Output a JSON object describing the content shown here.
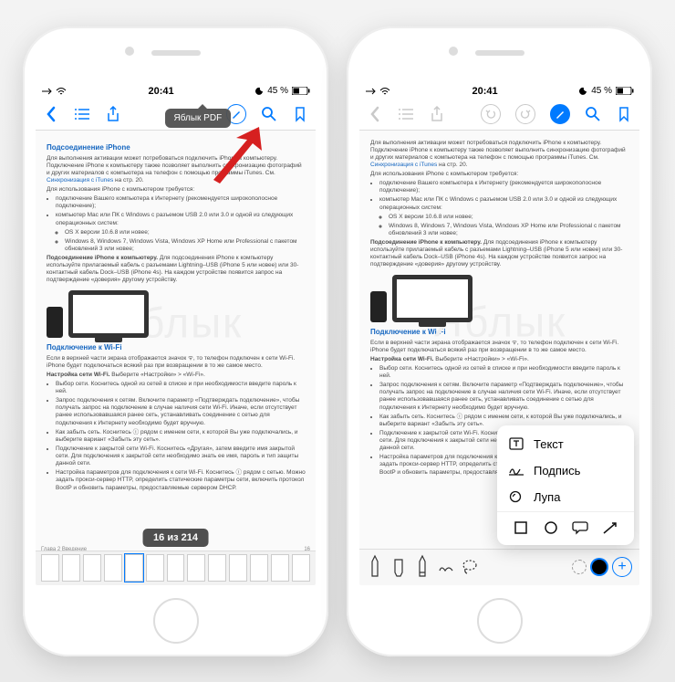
{
  "status": {
    "time": "20:41",
    "battery": "45 %"
  },
  "tooltip": "Яблык PDF",
  "page_indicator": "16 из 214",
  "watermark": "Яблык",
  "doc": {
    "h1": "Подсоединение iPhone",
    "p1": "Для выполнения активации может потребоваться подключить iPhone к компьютеру. Подключение iPhone к компьютеру также позволяет выполнить синхронизацию фотографий и других материалов с компьютера на телефон с помощью программы iTunes. См.",
    "link1": "Синхронизация с iTunes",
    "link1_after": " на стр. 20.",
    "p2": "Для использования iPhone с компьютером требуется:",
    "li1": "подключение Вашего компьютера к Интернету (рекомендуется широкополосное подключение);",
    "li2": "компьютер Mac или ПК с Windows с разъемом USB 2.0 или 3.0 и одной из следующих операционных систем:",
    "li2a": "OS X версии 10.6.8 или новее;",
    "li2b": "Windows 8, Windows 7, Windows Vista, Windows XP Home или Professional с пакетом обновлений 3 или новее;",
    "p3_strong": "Подсоединение iPhone к компьютеру.",
    "p3": " Для подсоединения iPhone к компьютеру используйте прилагаемый кабель с разъемами Lightning–USB (iPhone 5 или новее) или 30-контактный кабель Dock–USB (iPhone 4s). На каждом устройстве появится запрос на подтверждение «доверия» другому устройству.",
    "h2": "Подключение к Wi-Fi",
    "p4": "Если в верхней части экрана отображается значок ᯤ, то телефон подключен к сети Wi-Fi. iPhone будет подключаться всякий раз при возвращении в то же самое место.",
    "p5_strong": "Настройка сети Wi-Fi.",
    "p5": " Выберите «Настройки» > «Wi-Fi».",
    "li3": "Выбор сети. Коснитесь одной из сетей в списке и при необходимости введите пароль к ней.",
    "li4": "Запрос подключения к сетям. Включите параметр «Подтверждать подключение», чтобы получать запрос на подключение в случае наличия сети Wi-Fi. Иначе, если отсутствует ранее использовавшаяся ранее сеть, устанавливать соединение с сетью для подключения к Интернету необходимо будет вручную.",
    "li5": "Как забыть сеть. Коснитесь ⓘ рядом с именем сети, к которой Вы уже подключались, и выберите вариант «Забыть эту сеть».",
    "li6": "Подключение к закрытой сети Wi-Fi. Коснитесь «Другая», затем введите имя закрытой сети. Для подключения к закрытой сети необходимо знать ее имя, пароль и тип защиты данной сети.",
    "li7": "Настройка параметров для подключения к сети Wi-Fi. Коснитесь ⓘ рядом с сетью. Можно задать прокси-сервер HTTP, определить статические параметры сети, включить протокол BootP и обновить параметры, предоставляемые сервером DHCP.",
    "footer_left": "Глава 2   Введение",
    "footer_right": "16"
  },
  "popup": {
    "text": "Текст",
    "signature": "Подпись",
    "magnifier": "Лупа"
  },
  "icons": {
    "back": "back-chevron",
    "outline": "outline-list",
    "share": "share",
    "markup": "markup-pen",
    "search": "search",
    "bookmark": "bookmark"
  }
}
